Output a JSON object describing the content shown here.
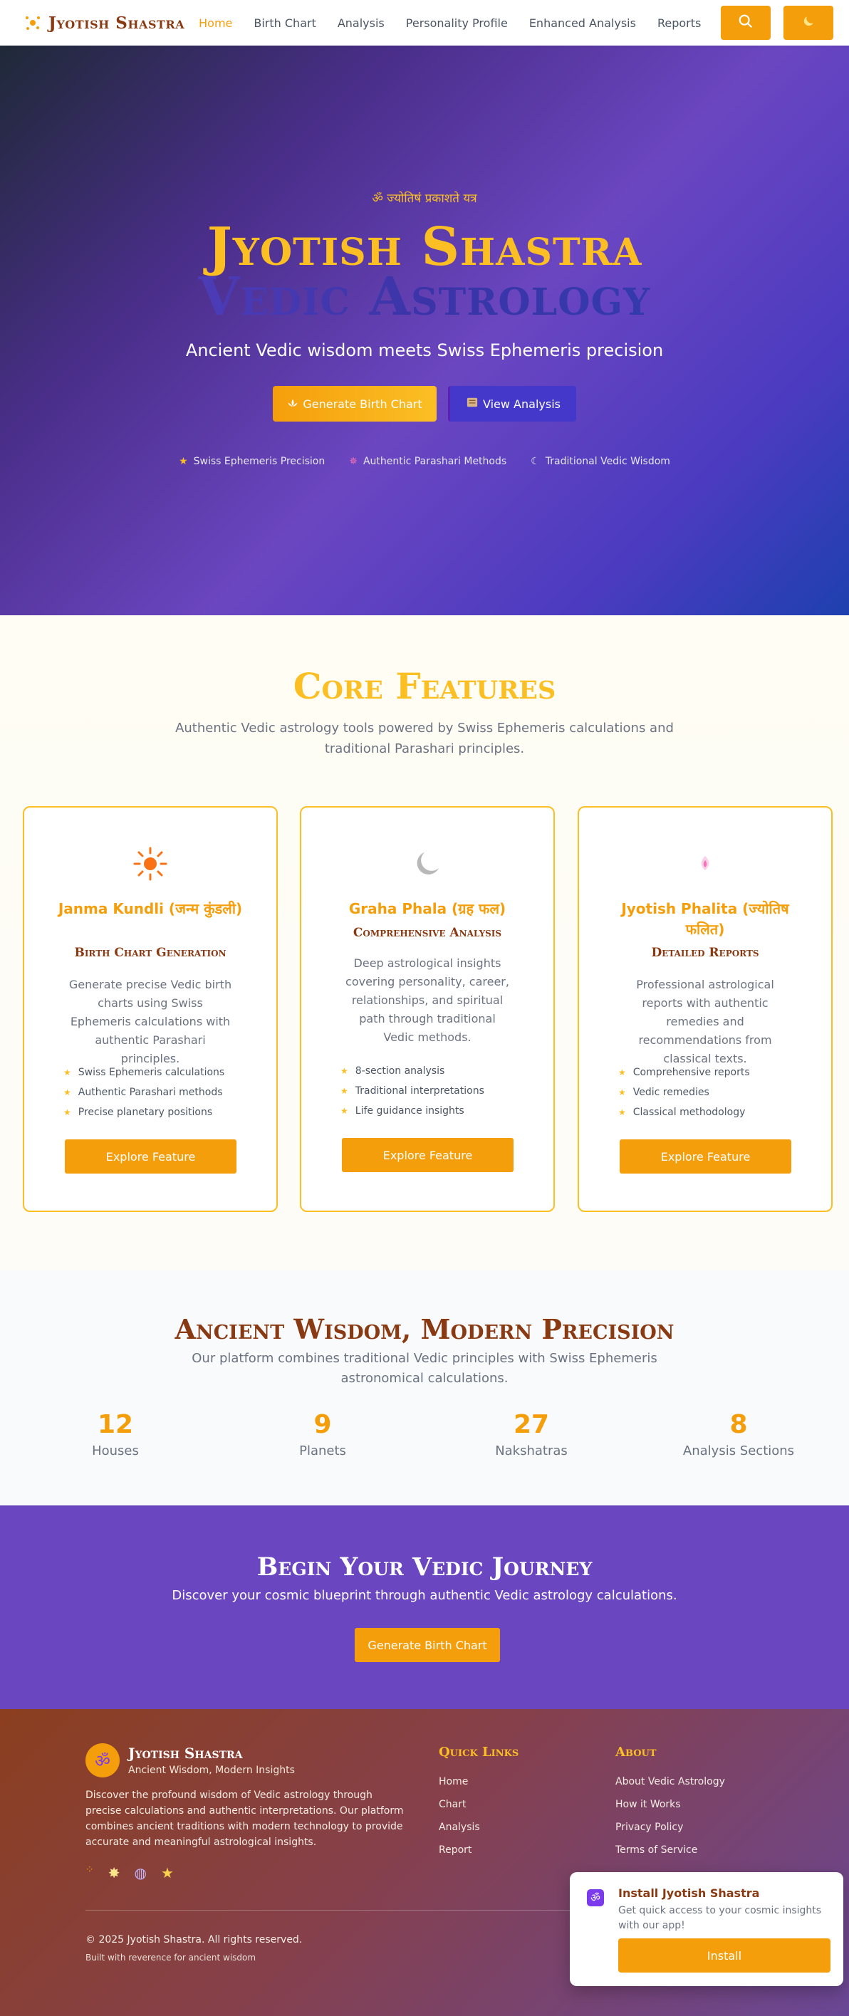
{
  "nav": {
    "brand": "Jyotish Shastra",
    "links": [
      "Home",
      "Birth Chart",
      "Analysis",
      "Personality Profile",
      "Enhanced Analysis",
      "Reports"
    ]
  },
  "hero": {
    "mantra": "ॐ ज्योतिषं प्रकाशते यत्र",
    "title": "Jyotish Shastra",
    "title2": "Vedic Astrology",
    "subtitle": "Ancient Vedic wisdom meets Swiss Ephemeris precision",
    "primary_button": "Generate Birth Chart",
    "secondary_button": "View Analysis",
    "badges": [
      "Swiss Ephemeris Precision",
      "Authentic Parashari Methods",
      "Traditional Vedic Wisdom"
    ]
  },
  "core": {
    "title": "Core Features",
    "subtitle": "Authentic Vedic astrology tools powered by Swiss Ephemeris calculations and traditional Parashari principles.",
    "cards": [
      {
        "icon": "sun-icon",
        "title": "Janma Kundli (जन्म कुंडली)",
        "subtitle": "Birth Chart Generation",
        "description": "Generate precise Vedic birth charts using Swiss Ephemeris calculations with authentic Parashari principles.",
        "features": [
          "Swiss Ephemeris calculations",
          "Authentic Parashari methods",
          "Precise planetary positions"
        ],
        "button": "Explore Feature"
      },
      {
        "icon": "moon-icon",
        "title": "Graha Phala (ग्रह फल)",
        "subtitle": "Comprehensive Analysis",
        "description": "Deep astrological insights covering personality, career, relationships, and spiritual path through traditional Vedic methods.",
        "features": [
          "8-section analysis",
          "Traditional interpretations",
          "Life guidance insights"
        ],
        "button": "Explore Feature"
      },
      {
        "icon": "lotus-icon",
        "title": "Jyotish Phalita (ज्योतिष फलित)",
        "subtitle": "Detailed Reports",
        "description": "Professional astrological reports with authentic remedies and recommendations from classical texts.",
        "features": [
          "Comprehensive reports",
          "Vedic remedies",
          "Classical methodology"
        ],
        "button": "Explore Feature"
      }
    ]
  },
  "stats": {
    "title": "Ancient Wisdom, Modern Precision",
    "subtitle": "Our platform combines traditional Vedic principles with Swiss Ephemeris astronomical calculations.",
    "items": [
      {
        "value": "12",
        "label": "Houses"
      },
      {
        "value": "9",
        "label": "Planets"
      },
      {
        "value": "27",
        "label": "Nakshatras"
      },
      {
        "value": "8",
        "label": "Analysis Sections"
      }
    ]
  },
  "cta": {
    "title": "Begin Your Vedic Journey",
    "subtitle": "Discover your cosmic blueprint through authentic Vedic astrology calculations.",
    "button": "Generate Birth Chart"
  },
  "footer": {
    "name": "Jyotish Shastra",
    "tagline": "Ancient Wisdom, Modern Insights",
    "description": "Discover the profound wisdom of Vedic astrology through precise calculations and authentic interpretations. Our platform combines ancient traditions with modern technology to provide accurate and meaningful astrological insights.",
    "quick_links_title": "Quick Links",
    "quick_links": [
      "Home",
      "Chart",
      "Analysis",
      "Report"
    ],
    "about_title": "About",
    "about_links": [
      "About Vedic Astrology",
      "How it Works",
      "Privacy Policy",
      "Terms of Service"
    ],
    "copyright": "© 2025 Jyotish Shastra. All rights reserved.",
    "built": "Built with reverence for ancient wisdom"
  },
  "install": {
    "title": "Install Jyotish Shastra",
    "text": "Get quick access to your cosmic insights with our app!",
    "button": "Install"
  },
  "colors": {
    "accent": "#f59e0b",
    "brand_brown": "#8a3a12",
    "purple": "#6b46c1"
  }
}
